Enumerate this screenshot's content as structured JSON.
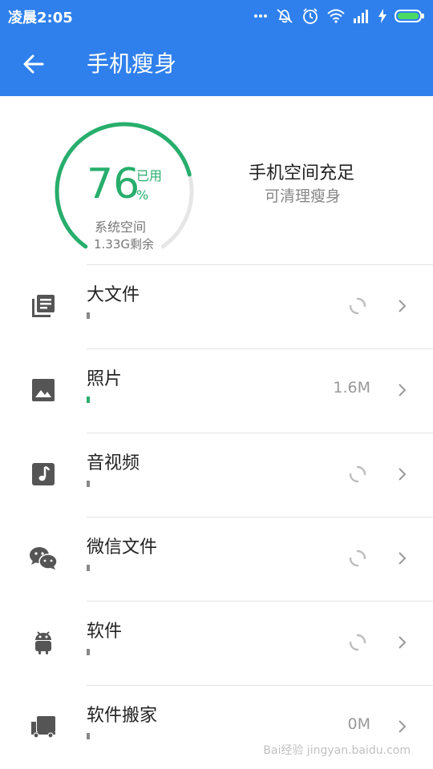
{
  "status_bar": {
    "time": "凌晨2:05",
    "icons": [
      "more-icon",
      "vibrate-off-icon",
      "alarm-icon",
      "wifi-icon",
      "signal-icon",
      "charging-icon",
      "battery-icon"
    ]
  },
  "app_bar": {
    "back_icon": "arrow-left-icon",
    "title": "手机瘦身"
  },
  "storage": {
    "used_percent": 76,
    "used_label": "已用",
    "percent_sign": "%",
    "system_label": "系统空间",
    "remaining": "1.33G剩余",
    "status_title": "手机空间充足",
    "status_subtitle": "可清理瘦身",
    "accent_color": "#27ae6c"
  },
  "items": [
    {
      "label": "大文件",
      "icon": "file-list-icon",
      "value": "",
      "loading": true
    },
    {
      "label": "照片",
      "icon": "image-icon",
      "value": "1.6M",
      "loading": false
    },
    {
      "label": "音视频",
      "icon": "music-note-icon",
      "value": "",
      "loading": true
    },
    {
      "label": "微信文件",
      "icon": "wechat-icon",
      "value": "",
      "loading": true
    },
    {
      "label": "软件",
      "icon": "android-icon",
      "value": "",
      "loading": true
    },
    {
      "label": "软件搬家",
      "icon": "truck-icon",
      "value": "0M",
      "loading": false
    }
  ],
  "watermark": "Bai经验 jingyan.baidu.com",
  "colors": {
    "header": "#2f80ed",
    "accent": "#27ae6c"
  }
}
